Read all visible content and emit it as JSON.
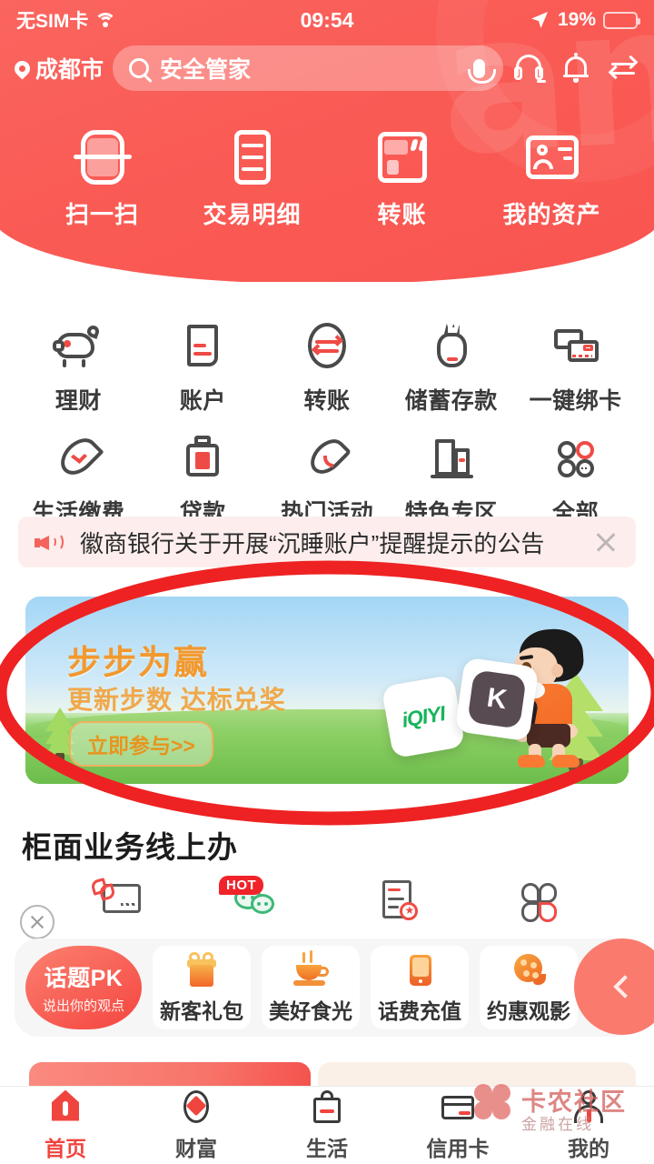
{
  "status_bar": {
    "carrier": "无SIM卡",
    "wifi_icon": "wifi-icon",
    "time": "09:54",
    "location_icon": "location-arrow-icon",
    "battery_percent": "19%",
    "battery_level": 19
  },
  "header": {
    "city": "成都市",
    "city_pin_icon": "location-pin-icon",
    "search": {
      "placeholder": "安全管家",
      "search_icon": "search-icon",
      "mic_icon": "microphone-icon"
    },
    "icons": [
      {
        "name": "customer-service-icon",
        "label": "客服"
      },
      {
        "name": "notification-bell-icon",
        "label": "消息"
      },
      {
        "name": "transfer-arrows-icon",
        "label": "转账"
      }
    ],
    "quick_actions": [
      {
        "label": "扫一扫",
        "icon": "scan-icon"
      },
      {
        "label": "交易明细",
        "icon": "transaction-list-icon"
      },
      {
        "label": "转账",
        "icon": "transfer-card-icon"
      },
      {
        "label": "我的资产",
        "icon": "id-card-icon"
      }
    ],
    "brand_color": "#FA5B55"
  },
  "grid_menu": {
    "row1": [
      {
        "label": "理财",
        "icon": "piggy-bank-icon"
      },
      {
        "label": "账户",
        "icon": "account-document-icon"
      },
      {
        "label": "转账",
        "icon": "transfer-circle-icon"
      },
      {
        "label": "储蓄存款",
        "icon": "money-bag-icon"
      },
      {
        "label": "一键绑卡",
        "icon": "bind-card-icon"
      }
    ],
    "row2": [
      {
        "label": "生活缴费",
        "icon": "water-drop-icon"
      },
      {
        "label": "贷款",
        "icon": "loan-box-icon"
      },
      {
        "label": "热门活动",
        "icon": "fire-icon"
      },
      {
        "label": "特色专区",
        "icon": "buildings-icon"
      },
      {
        "label": "全部",
        "icon": "all-grid-icon"
      }
    ]
  },
  "notice": {
    "speaker_icon": "speaker-icon",
    "text": "徽商银行关于开展“沉睡账户”提醒提示的公告",
    "close_icon": "close-icon"
  },
  "banner": {
    "title": "步步为赢",
    "subtitle": "更新步数 达标兑奖",
    "cta": "立即参与>>",
    "tiles": [
      {
        "name": "iqiyi-logo",
        "text": "iQIYI"
      },
      {
        "name": "keep-logo",
        "text": "K"
      }
    ],
    "character": "walking-boy-illustration",
    "title_color": "#F2992E"
  },
  "counter_section": {
    "title": "柜面业务线上办",
    "close_icon": "close-circle-icon",
    "items": [
      {
        "icon": "card-link-icon",
        "badge": ""
      },
      {
        "icon": "wechat-bubbles-icon",
        "badge": "HOT"
      },
      {
        "icon": "document-star-icon",
        "badge": ""
      },
      {
        "icon": "four-petal-grid-icon",
        "badge": ""
      }
    ]
  },
  "chips": {
    "pk": {
      "title": "话题PK",
      "subtitle": "说出你的观点"
    },
    "items": [
      {
        "label": "新客礼包",
        "icon": "gift-box-icon"
      },
      {
        "label": "美好食光",
        "icon": "coffee-cup-icon"
      },
      {
        "label": "话费充值",
        "icon": "mobile-phone-icon"
      },
      {
        "label": "约惠观影",
        "icon": "film-reel-icon"
      }
    ],
    "next_icon": "chevron-left-icon"
  },
  "bottom_nav": {
    "items": [
      {
        "label": "首页",
        "icon": "home-icon",
        "active": true
      },
      {
        "label": "财富",
        "icon": "diamond-icon",
        "active": false
      },
      {
        "label": "生活",
        "icon": "shopping-bag-icon",
        "active": false
      },
      {
        "label": "信用卡",
        "icon": "credit-card-icon",
        "active": false
      },
      {
        "label": "我的",
        "icon": "person-icon",
        "active": false
      }
    ],
    "active_color": "#F0453F"
  },
  "watermark": {
    "title": "卡农社区",
    "subtitle": "金融在线",
    "logo": "flower-logo"
  },
  "annotation": {
    "type": "ellipse-highlight",
    "color": "#EE2222",
    "target": "banner"
  }
}
